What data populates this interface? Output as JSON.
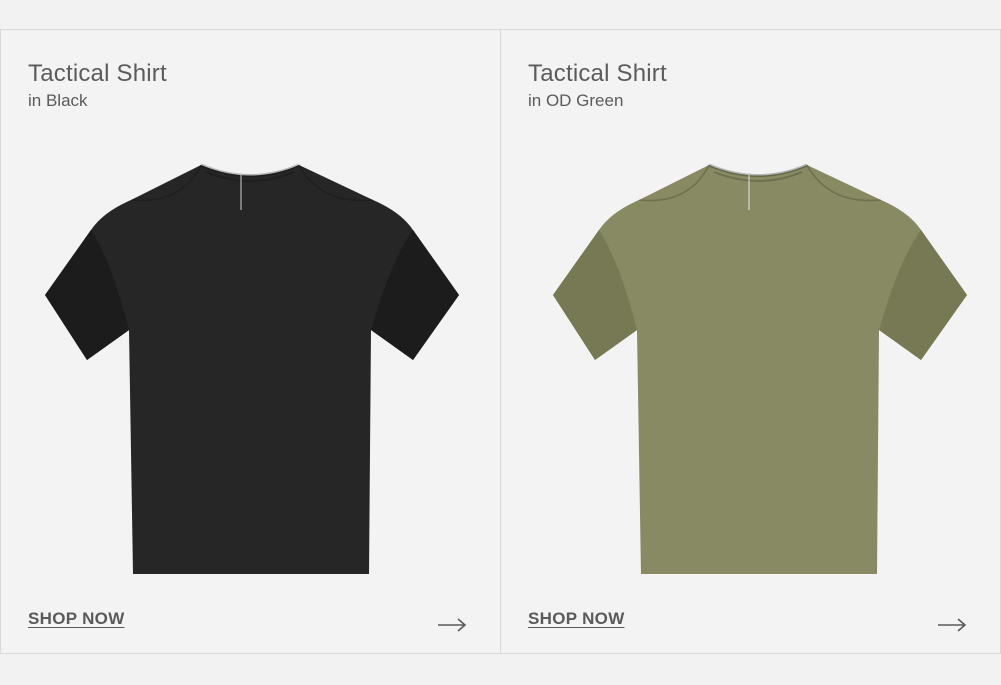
{
  "products": [
    {
      "title": "Tactical Shirt",
      "subtitle": "in Black",
      "cta": "SHOP NOW",
      "shirt_color": "#262626",
      "shirt_shade": "#1c1c1c",
      "arrow_icon": "arrow-right-icon"
    },
    {
      "title": "Tactical Shirt",
      "subtitle": "in OD Green",
      "cta": "SHOP NOW",
      "shirt_color": "#878a62",
      "shirt_shade": "#767953",
      "arrow_icon": "arrow-right-icon"
    }
  ]
}
